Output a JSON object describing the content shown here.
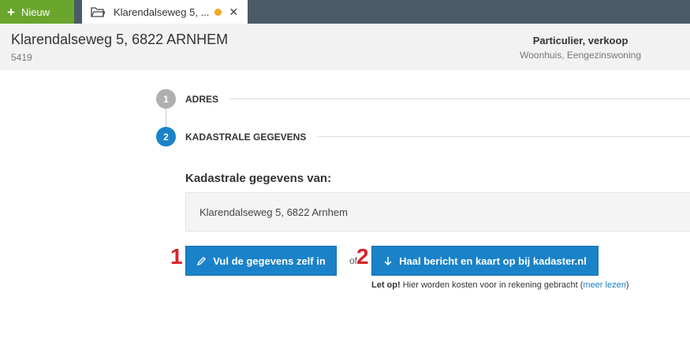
{
  "topbar": {
    "new_label": "Nieuw",
    "tab_title": "Klarendalseweg 5, ...",
    "tab_dot_color": "#f5a623",
    "close_glyph": "✕"
  },
  "header": {
    "title": "Klarendalseweg 5, 6822 ARNHEM",
    "id": "5419",
    "type": "Particulier, verkoop",
    "subtype": "Woonhuis, Eengezinswoning"
  },
  "steps": [
    {
      "number": "1",
      "label": "ADRES",
      "state": "completed"
    },
    {
      "number": "2",
      "label": "KADASTRALE GEGEVENS",
      "state": "active"
    }
  ],
  "kadaster": {
    "heading": "Kadastrale gegevens van:",
    "address": "Klarendalseweg 5, 6822 Arnhem"
  },
  "actions": {
    "manual_label": "Vul de gegevens zelf in",
    "or_text": "of",
    "fetch_label": "Haal bericht en kaart op bij kadaster.nl",
    "badge_1": "1",
    "badge_2": "2"
  },
  "warning": {
    "bold": "Let op!",
    "text": " Hier worden kosten voor in rekening gebracht (",
    "link": "meer lezen",
    "close": ")"
  },
  "colors": {
    "new_button": "#6aa52e",
    "topbar": "#4a5a66",
    "primary": "#1a82c8",
    "step_done": "#b0b0b0",
    "step_active": "#1a82c8",
    "badge": "#d9232d"
  }
}
